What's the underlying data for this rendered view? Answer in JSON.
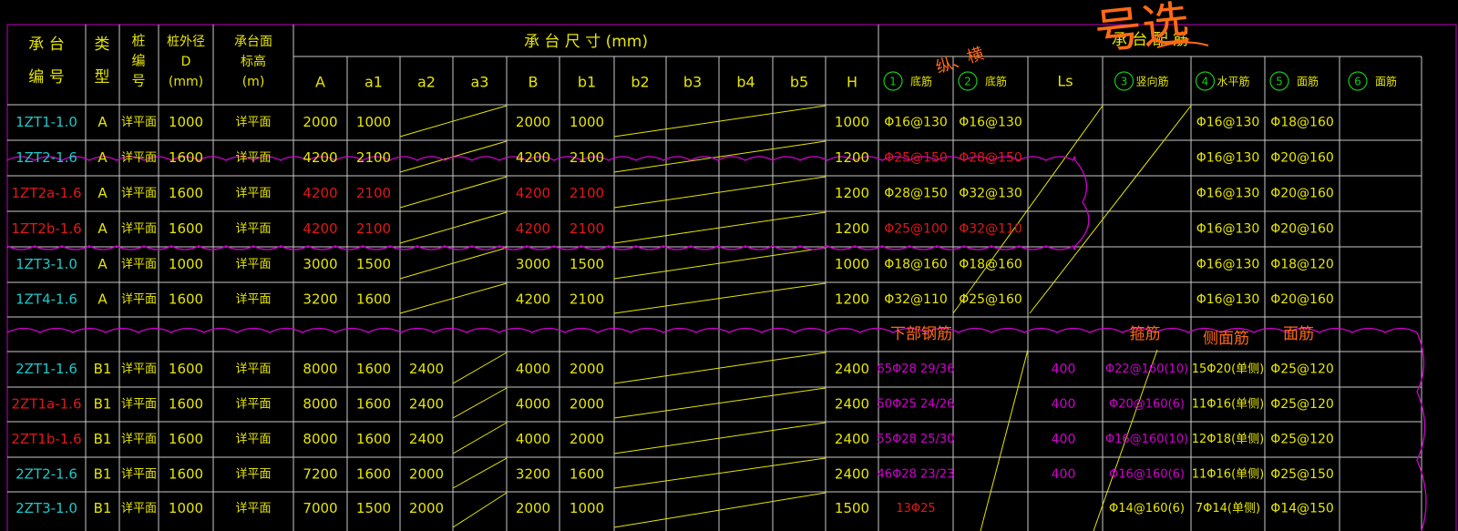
{
  "colors": {
    "background": "#000000",
    "grid": "#c8c8c8",
    "border": "#c000c0",
    "yellow": "#e6e600",
    "cyan": "#1ec8c8",
    "red": "#e01818",
    "magenta": "#d000d0",
    "green": "#18c818",
    "orange": "#ff6a14"
  },
  "handwriting": {
    "top_scribble": "号选",
    "left_note": "纵、横"
  },
  "headers": {
    "pile_cap_no": "承 台\n编 号",
    "type": "类\n型",
    "pile_no": "桩\n编\n号",
    "pile_dia": "桩外径\nD\n(mm)",
    "cap_top_elev": "承台面\n标高\n(m)",
    "cap_size": "承  台  尺  寸     (mm)",
    "cap_rebar": "承    台    配    筋",
    "sub": [
      "A",
      "a1",
      "a2",
      "a3",
      "B",
      "b1",
      "b2",
      "b3",
      "b4",
      "b5",
      "H"
    ],
    "rebar_cols": [
      {
        "num": "1",
        "label": "底筋"
      },
      {
        "num": "2",
        "label": "底筋"
      },
      {
        "num": "",
        "label": "Ls"
      },
      {
        "num": "3",
        "label": "竖向筋"
      },
      {
        "num": "4",
        "label": "水平筋"
      },
      {
        "num": "5",
        "label": "面筋"
      },
      {
        "num": "6",
        "label": "面筋"
      }
    ]
  },
  "rows_a": [
    {
      "id": "1ZT1-1.0",
      "id_color": "cyan",
      "type": "A",
      "pile": "详平面",
      "D": "1000",
      "elev": "详平面",
      "A": "2000",
      "a1": "1000",
      "B": "2000",
      "b1": "1000",
      "H": "1000",
      "r1": "Φ16@130",
      "r2": "Φ16@130",
      "r4": "Φ16@130",
      "r5": "Φ18@160",
      "red": false
    },
    {
      "id": "1ZT2-1.6",
      "id_color": "cyan",
      "type": "A",
      "pile": "详平面",
      "D": "1600",
      "elev": "详平面",
      "A": "4200",
      "a1": "2100",
      "B": "4200",
      "b1": "2100",
      "H": "1200",
      "r1": "Φ25@150",
      "r2": "Φ28@150",
      "r4": "Φ16@130",
      "r5": "Φ20@160",
      "red": false,
      "rebar_red": true
    },
    {
      "id": "1ZT2a-1.6",
      "id_color": "red",
      "type": "A",
      "pile": "详平面",
      "D": "1600",
      "elev": "详平面",
      "A": "4200",
      "a1": "2100",
      "B": "4200",
      "b1": "2100",
      "H": "1200",
      "r1": "Φ28@150",
      "r2": "Φ32@130",
      "r4": "Φ16@130",
      "r5": "Φ20@160",
      "red": true
    },
    {
      "id": "1ZT2b-1.6",
      "id_color": "red",
      "type": "A",
      "pile": "详平面",
      "D": "1600",
      "elev": "详平面",
      "A": "4200",
      "a1": "2100",
      "B": "4200",
      "b1": "2100",
      "H": "1200",
      "r1": "Φ25@100",
      "r2": "Φ32@110",
      "r4": "Φ16@130",
      "r5": "Φ20@160",
      "red": true,
      "rebar_red": true
    },
    {
      "id": "1ZT3-1.0",
      "id_color": "cyan",
      "type": "A",
      "pile": "详平面",
      "D": "1000",
      "elev": "详平面",
      "A": "3000",
      "a1": "1500",
      "B": "3000",
      "b1": "1500",
      "H": "1000",
      "r1": "Φ18@160",
      "r2": "Φ18@160",
      "r4": "Φ16@130",
      "r5": "Φ18@120",
      "red": false
    },
    {
      "id": "1ZT4-1.6",
      "id_color": "cyan",
      "type": "A",
      "pile": "详平面",
      "D": "1600",
      "elev": "详平面",
      "A": "3200",
      "a1": "1600",
      "B": "4200",
      "b1": "2100",
      "H": "1200",
      "r1": "Φ32@110",
      "r2": "Φ25@160",
      "r4": "Φ16@130",
      "r5": "Φ20@160",
      "red": false
    }
  ],
  "section_b_labels": {
    "bottom": "下部钢筋",
    "stirrup": "箍筋",
    "side": "侧面筋",
    "top": "面筋"
  },
  "rows_b": [
    {
      "id": "2ZT1-1.6",
      "id_color": "cyan",
      "type": "B1",
      "pile": "详平面",
      "D": "1600",
      "elev": "详平面",
      "A": "8000",
      "a1": "1600",
      "a2": "2400",
      "B": "4000",
      "b1": "2000",
      "H": "2400",
      "bottom": "65Φ28 29/36",
      "ls": "400",
      "stirrup": "Φ22@160(10)",
      "side": "15Φ20(单侧)",
      "top": "Φ25@120"
    },
    {
      "id": "2ZT1a-1.6",
      "id_color": "red",
      "type": "B1",
      "pile": "详平面",
      "D": "1600",
      "elev": "详平面",
      "A": "8000",
      "a1": "1600",
      "a2": "2400",
      "B": "4000",
      "b1": "2000",
      "H": "2400",
      "bottom": "50Φ25 24/26",
      "ls": "400",
      "stirrup": "Φ20@160(6)",
      "side": "11Φ16(单侧)",
      "top": "Φ25@120"
    },
    {
      "id": "2ZT1b-1.6",
      "id_color": "red",
      "type": "B1",
      "pile": "详平面",
      "D": "1600",
      "elev": "详平面",
      "A": "8000",
      "a1": "1600",
      "a2": "2400",
      "B": "4000",
      "b1": "2000",
      "H": "2400",
      "bottom": "55Φ28 25/30",
      "ls": "400",
      "stirrup": "Φ16@160(10)",
      "side": "12Φ18(单侧)",
      "top": "Φ25@120"
    },
    {
      "id": "2ZT2-1.6",
      "id_color": "cyan",
      "type": "B1",
      "pile": "详平面",
      "D": "1600",
      "elev": "详平面",
      "A": "7200",
      "a1": "1600",
      "a2": "2000",
      "B": "3200",
      "b1": "1600",
      "H": "2400",
      "bottom": "46Φ28 23/23",
      "ls": "400",
      "stirrup": "Φ16@160(6)",
      "side": "11Φ16(单侧)",
      "top": "Φ25@150"
    },
    {
      "id": "2ZT3-1.0",
      "id_color": "cyan",
      "type": "B1",
      "pile": "详平面",
      "D": "1000",
      "elev": "详平面",
      "A": "7000",
      "a1": "1500",
      "a2": "2000",
      "B": "2000",
      "b1": "1000",
      "H": "1500",
      "bottom": "13Φ25",
      "ls": "",
      "stirrup": "Φ14@160(6)",
      "side": "7Φ14(单侧)",
      "top": "Φ14@150",
      "bottom_red": true
    }
  ]
}
